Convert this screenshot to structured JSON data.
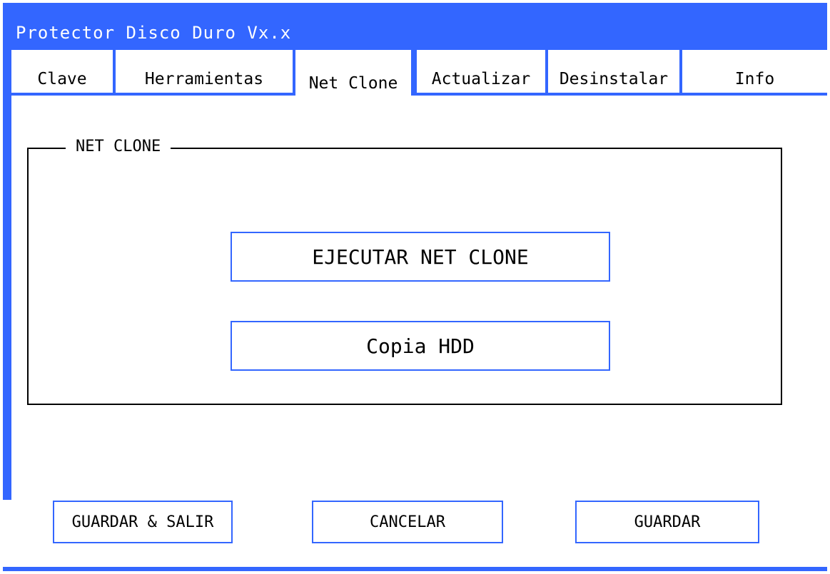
{
  "window": {
    "title": "Protector Disco Duro Vx.x"
  },
  "tabs": [
    {
      "label": "Clave"
    },
    {
      "label": "Herramientas"
    },
    {
      "label": "Net Clone",
      "active": true
    },
    {
      "label": "Actualizar"
    },
    {
      "label": "Desinstalar"
    },
    {
      "label": "Info"
    }
  ],
  "group": {
    "label": "NET CLONE",
    "run_label": "EJECUTAR NET CLONE",
    "copy_label": "Copia HDD"
  },
  "footer": {
    "save_exit_label": "GUARDAR & SALIR",
    "cancel_label": "CANCELAR",
    "save_label": "GUARDAR"
  },
  "colors": {
    "frame": "#3366ff",
    "panel": "#ffffff",
    "text": "#000000"
  }
}
